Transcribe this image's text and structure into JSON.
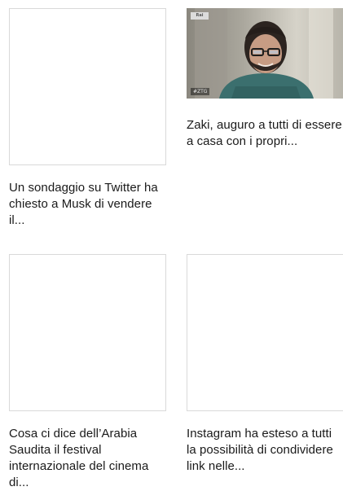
{
  "articles": [
    {
      "title": "Un sondaggio su Twitter ha chiesto a Musk di vendere il...",
      "thumbnail": "blank"
    },
    {
      "title": "Zaki, auguro a tutti di essere a casa con i propri...",
      "thumbnail": "video-still",
      "channel_logo": "Rai",
      "overlay_tag": "#ZTG"
    },
    {
      "title": "Cosa ci dice dell’Arabia Saudita il festival internazionale del cinema di...",
      "thumbnail": "blank"
    },
    {
      "title": "Instagram ha esteso a tutti la possibilità di condividere link nelle...",
      "thumbnail": "blank"
    }
  ],
  "colors": {
    "background": "#ffffff",
    "text": "#1a1a1a",
    "thumb_border": "#d9d9d9"
  }
}
